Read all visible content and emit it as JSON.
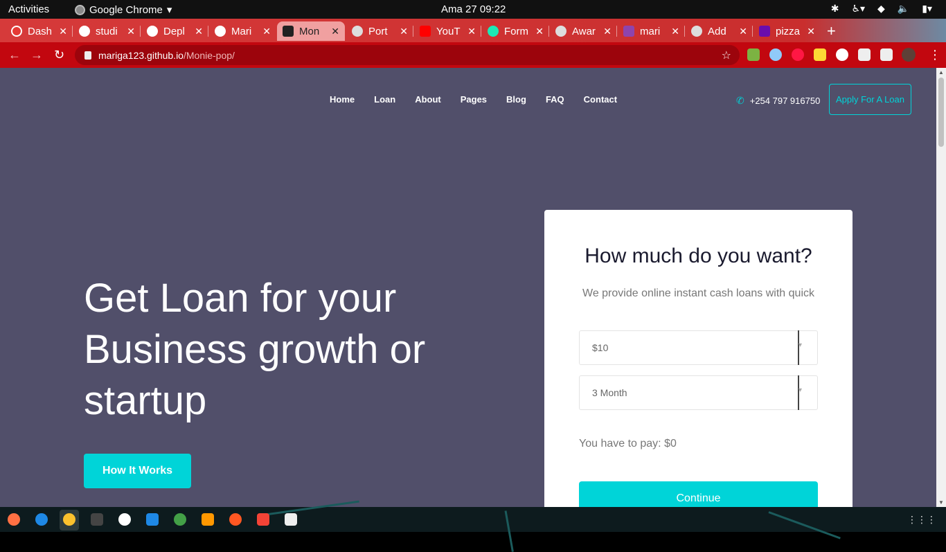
{
  "system": {
    "activities": "Activities",
    "app_name": "Google Chrome",
    "clock": "Ama 27  09:22"
  },
  "tabs": [
    {
      "label": "Dash",
      "color": "#e53935"
    },
    {
      "label": "studi",
      "color": "#ffffff"
    },
    {
      "label": "Depl",
      "color": "#ffffff"
    },
    {
      "label": "Mari",
      "color": "#ffffff"
    },
    {
      "label": "Mon",
      "color": "#222222",
      "active": true
    },
    {
      "label": "Port",
      "color": "#dddddd"
    },
    {
      "label": "YouT",
      "color": "#ff0000"
    },
    {
      "label": "Form",
      "color": "#1de9b6"
    },
    {
      "label": "Awar",
      "color": "#dddddd"
    },
    {
      "label": "mari",
      "color": "#8e44ad"
    },
    {
      "label": "Add",
      "color": "#dddddd"
    },
    {
      "label": "pizza",
      "color": "#6a0dad"
    }
  ],
  "address": {
    "host": "mariga123.github.io",
    "path": "/Monie-pop/"
  },
  "site": {
    "nav": [
      "Home",
      "Loan",
      "About",
      "Pages",
      "Blog",
      "FAQ",
      "Contact"
    ],
    "phone": "+254 797 916750",
    "apply_button": "Apply For A Loan",
    "hero_line1": "Get Loan for your",
    "hero_line2": "Business growth or",
    "hero_line3": "startup",
    "how_button": "How It Works",
    "accent": "#00d4d8",
    "background": "#514f6a"
  },
  "form": {
    "title": "How much do you want?",
    "subtitle": "We provide online instant cash loans with quick",
    "amount_value": "$10",
    "period_value": "3 Month",
    "pay_text": "You have to pay: $0",
    "continue_button": "Continue"
  }
}
